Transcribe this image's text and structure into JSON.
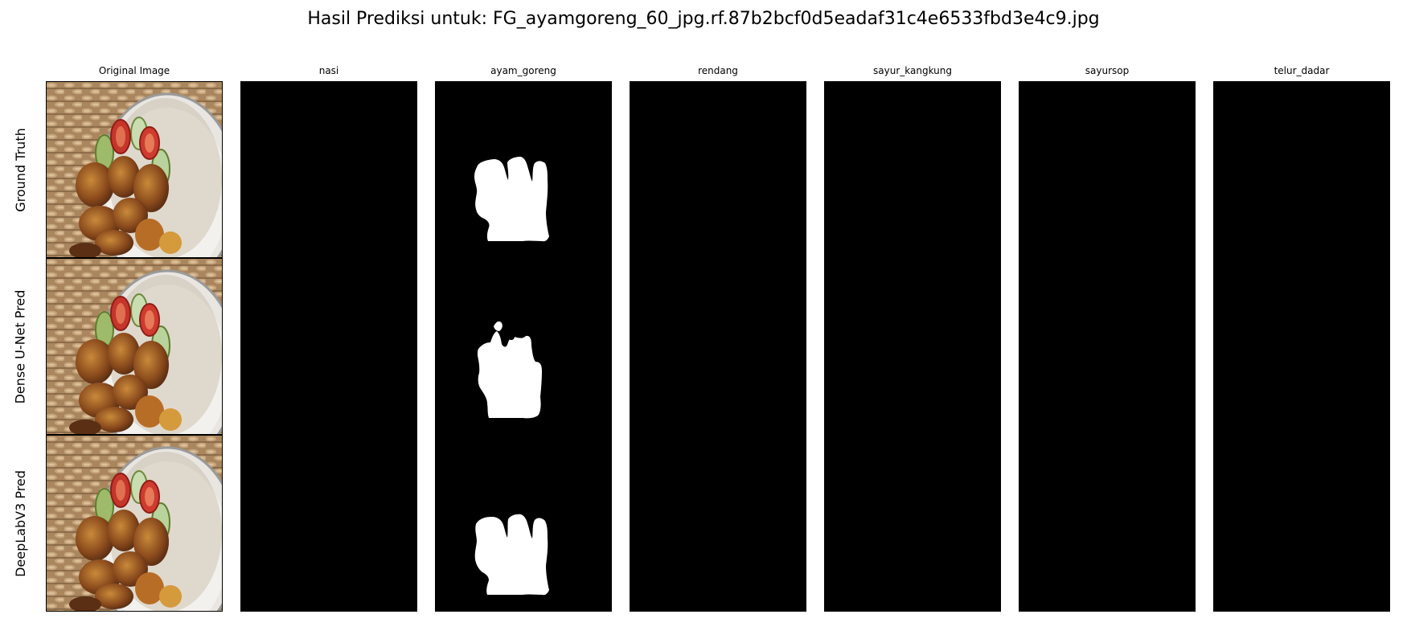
{
  "figure": {
    "title": "Hasil Prediksi untuk: FG_ayamgoreng_60_jpg.rf.87b2bcf0d5eadaf31c4e6533fbd3e4c9.jpg"
  },
  "columns": [
    {
      "title": "Original Image"
    },
    {
      "title": "nasi"
    },
    {
      "title": "ayam_goreng"
    },
    {
      "title": "rendang"
    },
    {
      "title": "sayur_kangkung"
    },
    {
      "title": "sayursop"
    },
    {
      "title": "telur_dadar"
    }
  ],
  "rows": [
    {
      "label": "Ground Truth"
    },
    {
      "label": "Dense U-Net Pred"
    },
    {
      "label": "DeepLabV3 Pred"
    }
  ],
  "colors": {
    "mask_background": "#000000",
    "mask_foreground": "#ffffff"
  },
  "masks_present": {
    "Ground Truth": [
      "ayam_goreng"
    ],
    "Dense U-Net Pred": [
      "ayam_goreng"
    ],
    "DeepLabV3 Pred": [
      "ayam_goreng"
    ]
  }
}
